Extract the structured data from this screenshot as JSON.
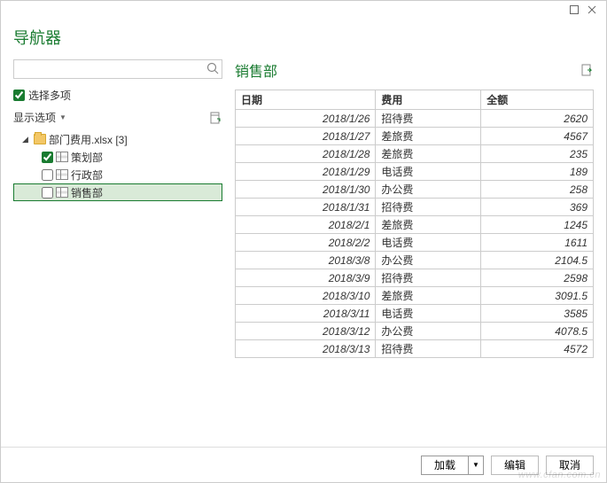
{
  "window": {
    "title": "导航器"
  },
  "left": {
    "multi_select_label": "选择多项",
    "multi_select_checked": true,
    "display_options_label": "显示选项",
    "file_label": "部门费用.xlsx [3]",
    "items": [
      {
        "label": "策划部",
        "checked": true
      },
      {
        "label": "行政部",
        "checked": false
      },
      {
        "label": "销售部",
        "checked": false
      }
    ]
  },
  "preview": {
    "title": "销售部",
    "columns": {
      "date": "日期",
      "fee": "费用",
      "amount": "全额"
    },
    "rows": [
      {
        "date": "2018/1/26",
        "fee": "招待费",
        "amount": "2620"
      },
      {
        "date": "2018/1/27",
        "fee": "差旅费",
        "amount": "4567"
      },
      {
        "date": "2018/1/28",
        "fee": "差旅费",
        "amount": "235"
      },
      {
        "date": "2018/1/29",
        "fee": "电话费",
        "amount": "189"
      },
      {
        "date": "2018/1/30",
        "fee": "办公费",
        "amount": "258"
      },
      {
        "date": "2018/1/31",
        "fee": "招待费",
        "amount": "369"
      },
      {
        "date": "2018/2/1",
        "fee": "差旅费",
        "amount": "1245"
      },
      {
        "date": "2018/2/2",
        "fee": "电话费",
        "amount": "1611"
      },
      {
        "date": "2018/3/8",
        "fee": "办公费",
        "amount": "2104.5"
      },
      {
        "date": "2018/3/9",
        "fee": "招待费",
        "amount": "2598"
      },
      {
        "date": "2018/3/10",
        "fee": "差旅费",
        "amount": "3091.5"
      },
      {
        "date": "2018/3/11",
        "fee": "电话费",
        "amount": "3585"
      },
      {
        "date": "2018/3/12",
        "fee": "办公费",
        "amount": "4078.5"
      },
      {
        "date": "2018/3/13",
        "fee": "招待费",
        "amount": "4572"
      }
    ]
  },
  "footer": {
    "load": "加载",
    "edit": "编辑",
    "cancel": "取消"
  },
  "watermark": "www.cfan.com.cn"
}
